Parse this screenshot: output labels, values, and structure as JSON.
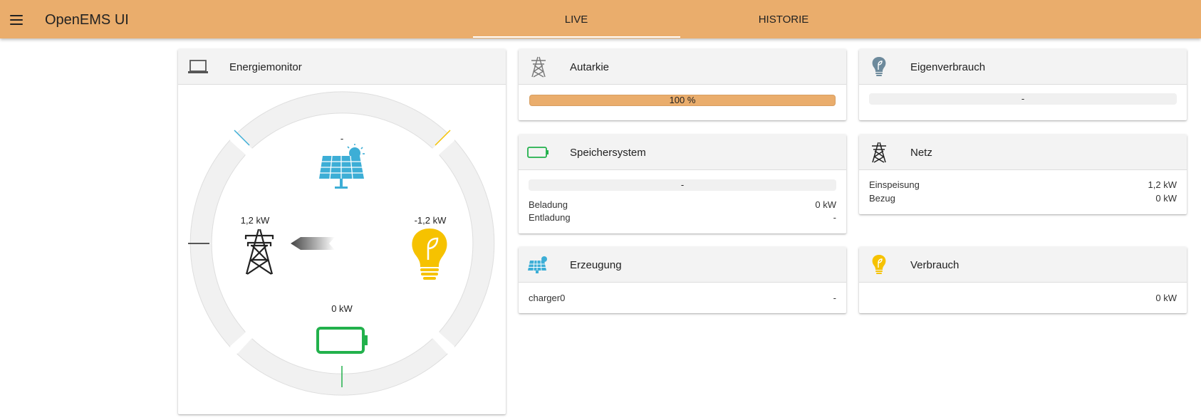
{
  "app": {
    "title": "OpenEMS UI"
  },
  "tabs": [
    {
      "label": "LIVE"
    },
    {
      "label": "HISTORIE"
    }
  ],
  "energiemonitor": {
    "title": "Energiemonitor",
    "production_value": "-",
    "grid_value": "1,2 kW",
    "consumption_value": "-1,2 kW",
    "storage_value": "0 kW"
  },
  "autarkie": {
    "title": "Autarkie",
    "bar_label": "100 %",
    "percent": 100
  },
  "eigenverbrauch": {
    "title": "Eigenverbrauch",
    "bar_label": "-"
  },
  "speichersystem": {
    "title": "Speichersystem",
    "bar_label": "-",
    "rows": [
      {
        "label": "Beladung",
        "value": "0 kW"
      },
      {
        "label": "Entladung",
        "value": "-"
      }
    ]
  },
  "netz": {
    "title": "Netz",
    "rows": [
      {
        "label": "Einspeisung",
        "value": "1,2 kW"
      },
      {
        "label": "Bezug",
        "value": "0 kW"
      }
    ]
  },
  "erzeugung": {
    "title": "Erzeugung",
    "rows": [
      {
        "label": "charger0",
        "value": "-"
      }
    ]
  },
  "verbrauch": {
    "title": "Verbrauch",
    "rows": [
      {
        "label": "",
        "value": "0 kW"
      }
    ]
  },
  "colors": {
    "topbar": "#eaad6c",
    "production": "#3daed6",
    "consumption": "#f6c200",
    "storage": "#22b14c",
    "grid": "#222222"
  },
  "icons": {
    "menu": "menu-icon",
    "energiemonitor": "laptop-icon",
    "autarkie": "grid-tower-icon",
    "eigenverbrauch": "lightbulb-icon",
    "speichersystem": "battery-icon",
    "netz": "grid-tower-icon",
    "erzeugung": "solar-panel-icon",
    "verbrauch": "lightbulb-icon"
  }
}
